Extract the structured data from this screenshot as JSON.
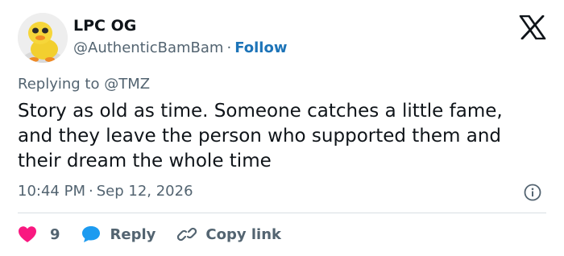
{
  "author": {
    "name": "LPC OG",
    "handle": "@AuthenticBamBam",
    "separator": "·",
    "follow_label": "Follow"
  },
  "icons": {
    "avatar": "yellow-duck-avatar",
    "logo": "x-logo-icon",
    "info": "info-icon",
    "like": "heart-icon",
    "reply": "speech-bubble-icon",
    "copy": "link-icon"
  },
  "reply_context": {
    "prefix": "Replying to",
    "mention": "@TMZ"
  },
  "tweet": {
    "text": "Story as old as time. Someone catches a little fame, and they leave the person who supported them and their dream the whole time",
    "time": "10:44 PM",
    "separator": "·",
    "date": "Sep 12, 2026"
  },
  "actions": {
    "like_count": "9",
    "reply_label": "Reply",
    "copy_label": "Copy link"
  },
  "colors": {
    "text": "#0f1419",
    "secondary": "#536471",
    "link": "#1d74b8",
    "like": "#f91880",
    "reply": "#1d9bf0"
  }
}
